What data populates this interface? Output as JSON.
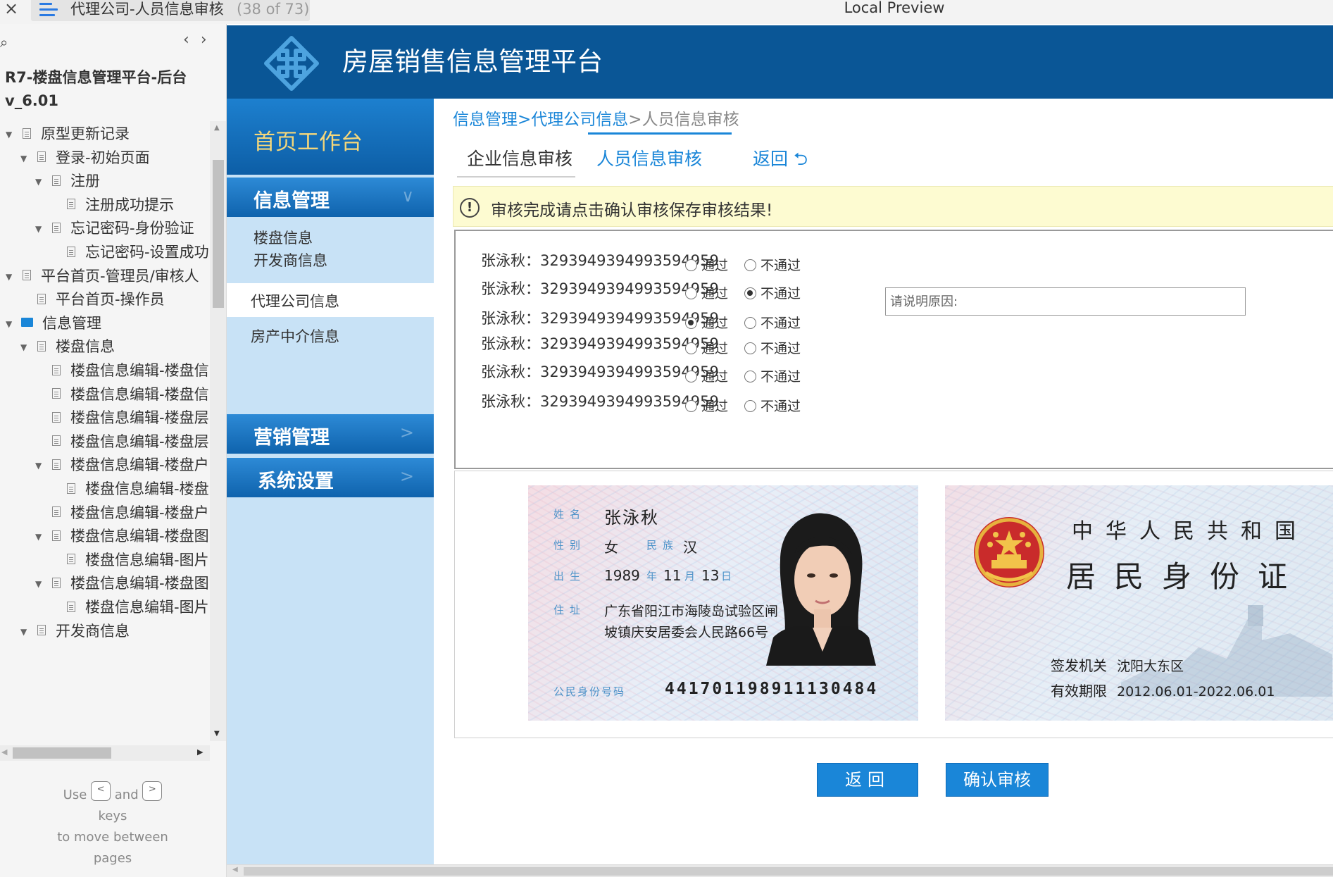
{
  "top_bar": {
    "close": "×",
    "page_title": "代理公司-人员信息审核",
    "page_count": "(38 of 73)",
    "preview_label": "Local Preview"
  },
  "left_panel": {
    "search_glyph": "⌕",
    "prev_glyph": "‹",
    "next_glyph": "›",
    "project_title": "R7-楼盘信息管理平台-后台 v_6.01",
    "tree": [
      {
        "label": "原型更新记录",
        "level": 0,
        "kind": "page",
        "expanded": true
      },
      {
        "label": "登录-初始页面",
        "level": 1,
        "kind": "page",
        "expanded": true
      },
      {
        "label": "注册",
        "level": 2,
        "kind": "page",
        "expanded": true
      },
      {
        "label": "注册成功提示",
        "level": 3,
        "kind": "page",
        "expanded": false
      },
      {
        "label": "忘记密码-身份验证",
        "level": 2,
        "kind": "page",
        "expanded": true
      },
      {
        "label": "忘记密码-设置成功",
        "level": 3,
        "kind": "page",
        "expanded": false
      },
      {
        "label": "平台首页-管理员/审核人",
        "level": 0,
        "kind": "page",
        "expanded": true
      },
      {
        "label": "平台首页-操作员",
        "level": 1,
        "kind": "page",
        "expanded": false
      },
      {
        "label": "信息管理",
        "level": 0,
        "kind": "folder",
        "expanded": true
      },
      {
        "label": "楼盘信息",
        "level": 1,
        "kind": "page",
        "expanded": true
      },
      {
        "label": "楼盘信息编辑-楼盘信",
        "level": 2,
        "kind": "page",
        "expanded": false
      },
      {
        "label": "楼盘信息编辑-楼盘信",
        "level": 2,
        "kind": "page",
        "expanded": false
      },
      {
        "label": "楼盘信息编辑-楼盘层",
        "level": 2,
        "kind": "page",
        "expanded": false
      },
      {
        "label": "楼盘信息编辑-楼盘层",
        "level": 2,
        "kind": "page",
        "expanded": false
      },
      {
        "label": "楼盘信息编辑-楼盘户",
        "level": 2,
        "kind": "page",
        "expanded": true
      },
      {
        "label": "楼盘信息编辑-楼盘",
        "level": 3,
        "kind": "page",
        "expanded": false
      },
      {
        "label": "楼盘信息编辑-楼盘户",
        "level": 2,
        "kind": "page",
        "expanded": false
      },
      {
        "label": "楼盘信息编辑-楼盘图",
        "level": 2,
        "kind": "page",
        "expanded": true
      },
      {
        "label": "楼盘信息编辑-图片",
        "level": 3,
        "kind": "page",
        "expanded": false
      },
      {
        "label": "楼盘信息编辑-楼盘图",
        "level": 2,
        "kind": "page",
        "expanded": true
      },
      {
        "label": "楼盘信息编辑-图片",
        "level": 3,
        "kind": "page",
        "expanded": false
      },
      {
        "label": "开发商信息",
        "level": 1,
        "kind": "page",
        "expanded": true
      }
    ],
    "help": {
      "use": "Use",
      "and": "and",
      "keys": "keys",
      "line2": "to move between",
      "line3": "pages",
      "prev_key": "<",
      "next_key": ">"
    }
  },
  "app": {
    "title": "房屋销售信息管理平台",
    "colors": {
      "header": "#0a5696",
      "nav_light": "#c8e2f6",
      "accent": "#1a86d8",
      "home_text": "#f5d77a",
      "notice_bg": "#fdfbd1"
    },
    "nav": {
      "home": "首页工作台",
      "info_section": "信息管理",
      "info_chevron": "∨",
      "info_items": [
        "楼盘信息",
        "开发商信息",
        "代理公司信息",
        "房产中介信息"
      ],
      "active_item": "代理公司信息",
      "marketing": "营销管理",
      "settings": "系统设置",
      "collapsed_chevron": ">"
    }
  },
  "main": {
    "breadcrumb": {
      "root": "信息管理",
      "sep": ">",
      "parent": "代理公司信息",
      "current": "人员信息审核"
    },
    "tabs": {
      "company": "企业信息审核",
      "staff": "人员信息审核",
      "back": "返回",
      "back_icon": "⮌"
    },
    "notice": {
      "icon": "!",
      "text": "审核完成请点击确认审核保存审核结果!"
    },
    "review_rows": [
      {
        "person": "张泳秋：3293949394993594959",
        "pass_label": "通过",
        "fail_label": "不通过",
        "selected": "none"
      },
      {
        "person": "张泳秋：3293949394993594959",
        "pass_label": "通过",
        "fail_label": "不通过",
        "selected": "fail"
      },
      {
        "person": "张泳秋：3293949394993594959",
        "pass_label": "通过",
        "fail_label": "不通过",
        "selected": "pass"
      },
      {
        "person": "张泳秋：3293949394993594959",
        "pass_label": "通过",
        "fail_label": "不通过",
        "selected": "none"
      },
      {
        "person": "张泳秋：3293949394993594959",
        "pass_label": "通过",
        "fail_label": "不通过",
        "selected": "none"
      },
      {
        "person": "张泳秋：3293949394993594959",
        "pass_label": "通过",
        "fail_label": "不通过",
        "selected": "none"
      }
    ],
    "reason_placeholder": "请说明原因:",
    "id_front": {
      "name_label": "姓名",
      "name": "张泳秋",
      "gender_label": "性别",
      "gender": "女",
      "ethnicity_label": "民族",
      "ethnicity": "汉",
      "birth_label": "出生",
      "birth_year": "1989",
      "year_unit": "年",
      "birth_month": "11",
      "month_unit": "月",
      "birth_day": "13",
      "day_unit": "日",
      "address_label": "住址",
      "address": "广东省阳江市海陵岛试验区闸坡镇庆安居委会人民路66号",
      "id_label": "公民身份号码",
      "id_number": "441701198911130484"
    },
    "id_back": {
      "country": "中华人民共和国",
      "card_name": "居民身份证",
      "authority_label": "签发机关",
      "authority": "沈阳大东区",
      "validity_label": "有效期限",
      "validity": "2012.06.01-2022.06.01"
    },
    "buttons": {
      "back": "返回",
      "confirm": "确认审核"
    }
  }
}
